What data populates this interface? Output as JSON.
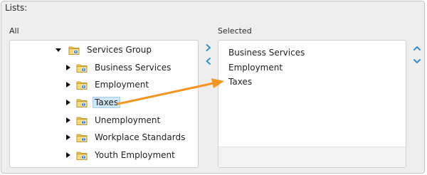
{
  "lists_label": "Lists:",
  "all": {
    "label": "All",
    "tree": [
      {
        "label": "Services Group",
        "expanded": true,
        "selected": false
      },
      {
        "label": "Business Services",
        "expanded": false,
        "selected": false
      },
      {
        "label": "Employment",
        "expanded": false,
        "selected": false
      },
      {
        "label": "Taxes",
        "expanded": false,
        "selected": true
      },
      {
        "label": "Unemployment",
        "expanded": false,
        "selected": false
      },
      {
        "label": "Workplace Standards",
        "expanded": false,
        "selected": false
      },
      {
        "label": "Youth Employment",
        "expanded": false,
        "selected": false
      }
    ]
  },
  "selected": {
    "label": "Selected",
    "items": [
      "Business Services",
      "Employment",
      "Taxes"
    ]
  },
  "icons": {
    "move_right": "chevron-right-icon",
    "move_left": "chevron-left-icon",
    "move_up": "chevron-up-icon",
    "move_down": "chevron-down-icon",
    "folder": "folder-group-icon",
    "annotation": "orange-arrow"
  },
  "colors": {
    "accent_blue": "#3a8fd0",
    "selection_bg": "#cfe6f5",
    "annotation_orange": "#f3951f"
  }
}
